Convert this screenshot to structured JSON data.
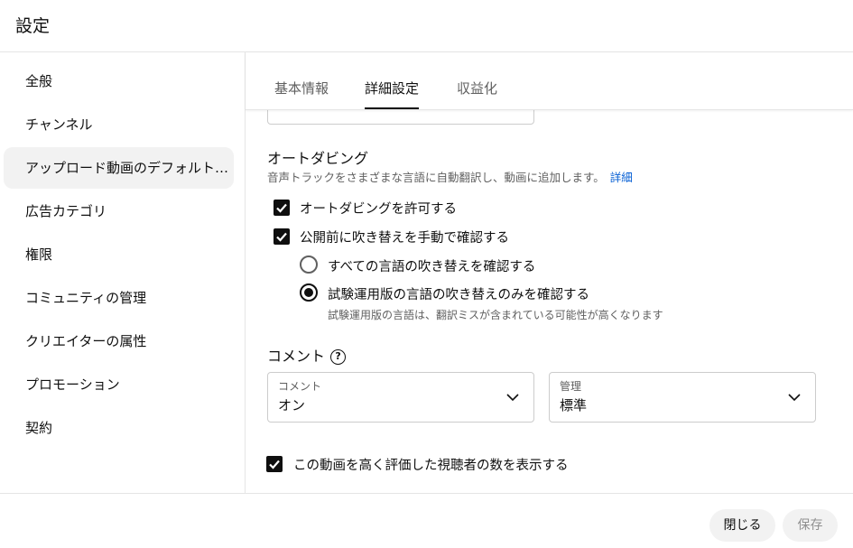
{
  "header": {
    "title": "設定"
  },
  "sidebar": {
    "items": [
      {
        "label": "全般"
      },
      {
        "label": "チャンネル"
      },
      {
        "label": "アップロード動画のデフォルト設定"
      },
      {
        "label": "広告カテゴリ"
      },
      {
        "label": "権限"
      },
      {
        "label": "コミュニティの管理"
      },
      {
        "label": "クリエイターの属性"
      },
      {
        "label": "プロモーション"
      },
      {
        "label": "契約"
      }
    ],
    "active_index": 2
  },
  "tabs": [
    {
      "label": "基本情報"
    },
    {
      "label": "詳細設定"
    },
    {
      "label": "収益化"
    }
  ],
  "active_tab": 1,
  "autodub": {
    "title": "オートダビング",
    "description": "音声トラックをさまざまな言語に自動翻訳し、動画に追加します。",
    "learn_more": "詳細",
    "allow_label": "オートダビングを許可する",
    "allow_checked": true,
    "review_label": "公開前に吹き替えを手動で確認する",
    "review_checked": true,
    "radio_all_label": "すべての言語の吹き替えを確認する",
    "radio_trial_label": "試験運用版の言語の吹き替えのみを確認する",
    "radio_selected": "trial",
    "trial_hint": "試験運用版の言語は、翻訳ミスが含まれている可能性が高くなります"
  },
  "comments": {
    "title": "コメント",
    "help_icon": "?",
    "comment_select": {
      "label": "コメント",
      "value": "オン"
    },
    "moderation_select": {
      "label": "管理",
      "value": "標準"
    }
  },
  "likes": {
    "label": "この動画を高く評価した視聴者の数を表示する",
    "checked": true
  },
  "footer": {
    "close_label": "閉じる",
    "save_label": "保存"
  },
  "colors": {
    "accent": "#0f0f0f",
    "link": "#065fd4",
    "muted": "#606060"
  }
}
